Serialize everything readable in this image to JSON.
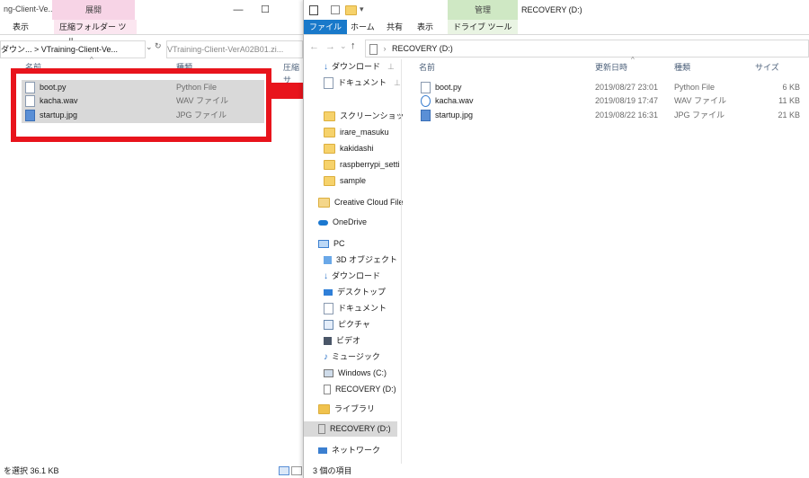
{
  "left": {
    "title_partial": "ng-Client-Ve...",
    "ctx_group": "展開",
    "ribbon_tabs": [
      "表示",
      "圧縮フォルダー ツール"
    ],
    "address": "ダウン...  >  VTraining-Client-Ve...",
    "address2": "VTraining-Client-VerA02B01.zi...",
    "col_name": "名前",
    "col_type": "種類",
    "col_size": "圧縮サ",
    "files": [
      {
        "name": "boot.py",
        "type": "Python File"
      },
      {
        "name": "kacha.wav",
        "type": "WAV ファイル"
      },
      {
        "name": "startup.jpg",
        "type": "JPG ファイル"
      }
    ],
    "status": "を選択  36.1 KB"
  },
  "right": {
    "title": "RECOVERY (D:)",
    "ctx_group": "管理",
    "ribbon_tabs": [
      "ファイル",
      "ホーム",
      "共有",
      "表示",
      "ドライブ ツール"
    ],
    "address": "RECOVERY (D:)",
    "col_name": "名前",
    "col_date": "更新日時",
    "col_type": "種類",
    "col_size": "サイズ",
    "files": [
      {
        "name": "boot.py",
        "date": "2019/08/27 23:01",
        "type": "Python File",
        "size": "6 KB"
      },
      {
        "name": "kacha.wav",
        "date": "2019/08/19 17:47",
        "type": "WAV ファイル",
        "size": "11 KB"
      },
      {
        "name": "startup.jpg",
        "date": "2019/08/22 16:31",
        "type": "JPG ファイル",
        "size": "21 KB"
      }
    ],
    "nav": [
      "ダウンロード",
      "ドキュメント",
      "スクリーンショッ",
      "irare_masuku",
      "kakidashi",
      "raspberrypi_setti",
      "sample",
      "Creative Cloud File",
      "OneDrive",
      "PC",
      "3D オブジェクト",
      "ダウンロード",
      "デスクトップ",
      "ドキュメント",
      "ピクチャ",
      "ビデオ",
      "ミュージック",
      "Windows (C:)",
      "RECOVERY (D:)",
      "ライブラリ",
      "RECOVERY (D:)",
      "ネットワーク"
    ],
    "status": "3 個の項目"
  },
  "annotation": {
    "color": "#e8141c"
  }
}
